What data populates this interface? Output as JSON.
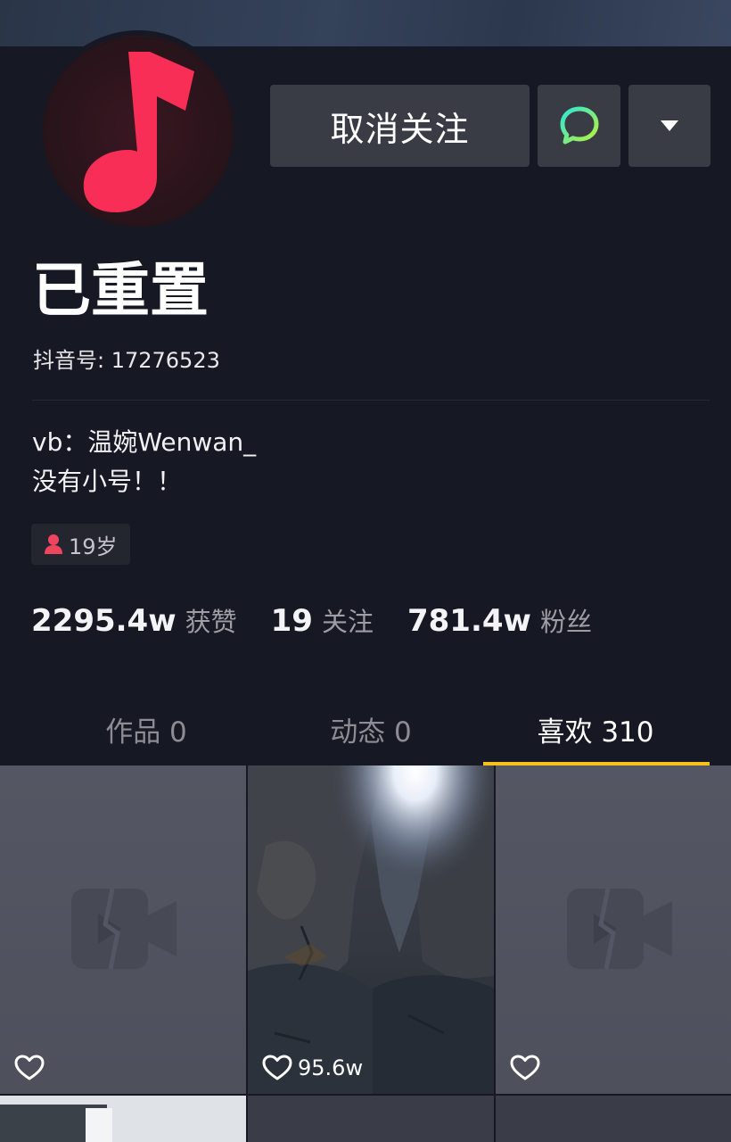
{
  "header": {
    "unfollow_label": "取消关注",
    "message_icon": "chat-bubble-icon",
    "more_icon": "caret-down-icon"
  },
  "profile": {
    "avatar_icon": "music-note-icon",
    "nickname": "已重置",
    "douyin_id": "抖音号: 17276523",
    "bio": [
      "vb：温婉Wenwan_",
      "没有小号！！"
    ],
    "age_tag": "19岁"
  },
  "stats": [
    {
      "value": "2295.4w",
      "label": "获赞"
    },
    {
      "value": "19",
      "label": "关注"
    },
    {
      "value": "781.4w",
      "label": "粉丝"
    }
  ],
  "tabs": [
    {
      "label": "作品 0",
      "active": false
    },
    {
      "label": "动态 0",
      "active": false
    },
    {
      "label": "喜欢 310",
      "active": true
    }
  ],
  "grid": [
    {
      "type": "placeholder",
      "likes": ""
    },
    {
      "type": "photo",
      "likes": "95.6w"
    },
    {
      "type": "placeholder",
      "likes": ""
    }
  ],
  "colors": {
    "background": "#161823",
    "button": "#393b45",
    "accent_yellow": "#f5c219",
    "brand_red": "#fe2c55"
  }
}
